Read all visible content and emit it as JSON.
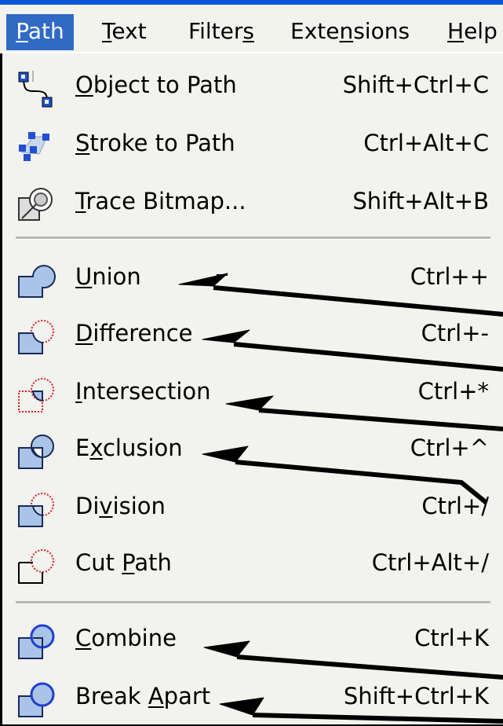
{
  "menubar": {
    "items": [
      {
        "label": "Path",
        "hot": "P",
        "active": true
      },
      {
        "label": "Text",
        "hot": "T",
        "active": false
      },
      {
        "label": "Filters",
        "hot": "s",
        "active": false
      },
      {
        "label": "Extensions",
        "hot": "n",
        "active": false
      },
      {
        "label": "Help",
        "hot": "H",
        "active": false
      }
    ]
  },
  "menu": {
    "items": [
      {
        "label": "Object to Path",
        "hot": "O",
        "shortcut": "Shift+Ctrl+C",
        "icon": "object-to-path-icon"
      },
      {
        "label": "Stroke to Path",
        "hot": "S",
        "shortcut": "Ctrl+Alt+C",
        "icon": "stroke-to-path-icon"
      },
      {
        "label": "Trace Bitmap...",
        "hot": "T",
        "shortcut": "Shift+Alt+B",
        "icon": "trace-bitmap-icon"
      },
      {
        "label": "Union",
        "hot": "U",
        "shortcut": "Ctrl++",
        "icon": "union-icon"
      },
      {
        "label": "Difference",
        "hot": "D",
        "shortcut": "Ctrl+-",
        "icon": "difference-icon"
      },
      {
        "label": "Intersection",
        "hot": "I",
        "shortcut": "Ctrl+*",
        "icon": "intersection-icon"
      },
      {
        "label": "Exclusion",
        "hot": "x",
        "shortcut": "Ctrl+^",
        "icon": "exclusion-icon"
      },
      {
        "label": "Division",
        "hot": "v",
        "shortcut": "Ctrl+/",
        "icon": "division-icon"
      },
      {
        "label": "Cut Path",
        "hot": "P",
        "shortcut": "Ctrl+Alt+/",
        "icon": "cut-path-icon"
      },
      {
        "label": "Combine",
        "hot": "C",
        "shortcut": "Ctrl+K",
        "icon": "combine-icon"
      },
      {
        "label": "Break Apart",
        "hot": "A",
        "shortcut": "Shift+Ctrl+K",
        "icon": "break-apart-icon"
      }
    ]
  },
  "colors": {
    "accent": "#316ac5",
    "menu_bg": "#f2f2ee",
    "shape_fill": "#a9c4e6",
    "shape_stroke": "#1a2a5a",
    "dotted_red": "#d62020"
  }
}
